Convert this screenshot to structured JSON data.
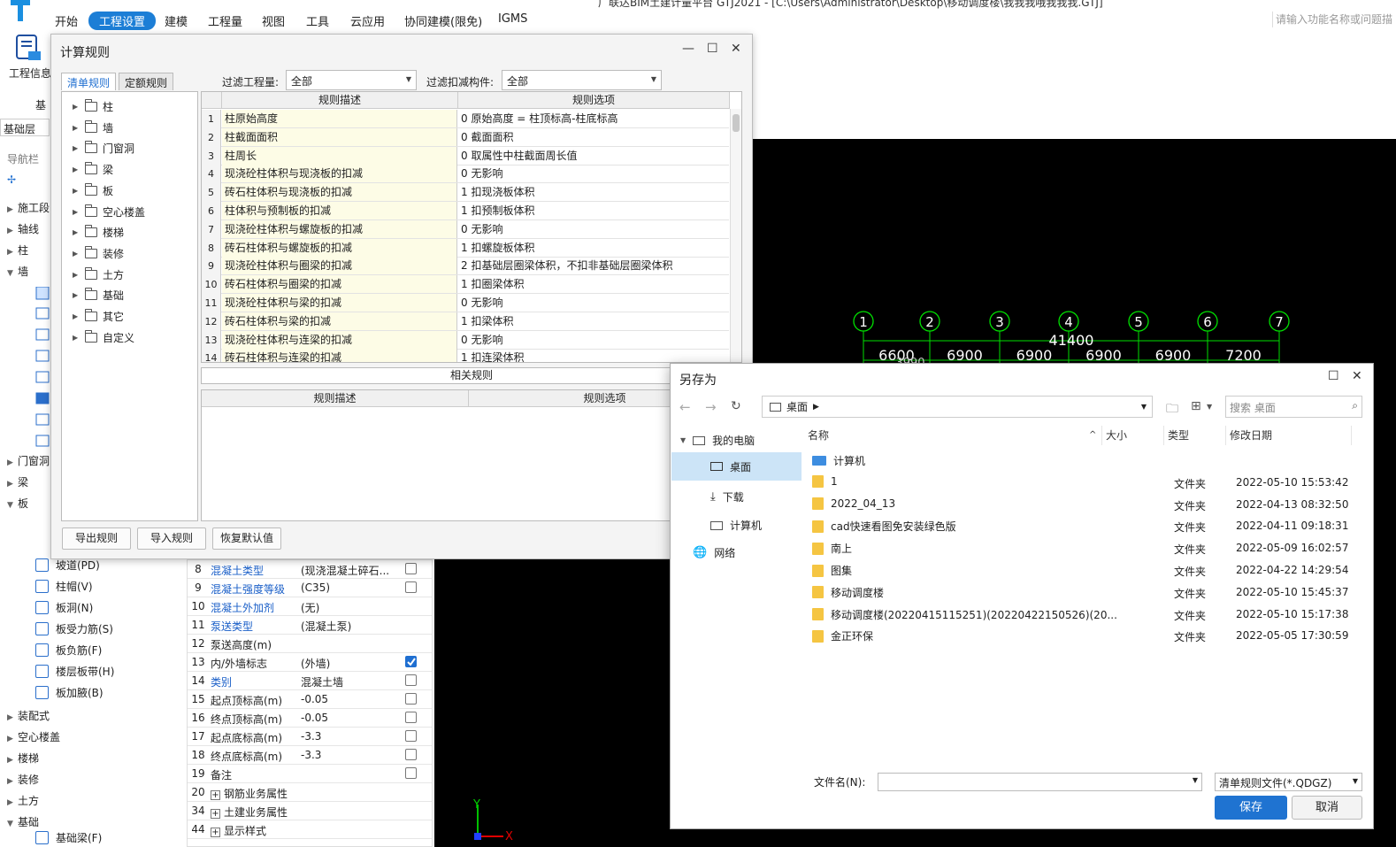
{
  "ribbon": {
    "title": "广联达BIM土建计量平台 GTJ2021 - [C:\\Users\\Administrator\\Desktop\\移动调度楼\\我我我哦我我我.GTJ]",
    "menus": [
      "开始",
      "工程设置",
      "建模",
      "工程量",
      "视图",
      "工具",
      "云应用",
      "协同建模(限免)",
      "IGMS"
    ],
    "active_menu": "工程设置",
    "search_placeholder": "请输入功能名称或问题描",
    "project_info": "工程信息"
  },
  "left": {
    "layer": "基础层",
    "nav_title": "导航栏",
    "truncated_label": "基",
    "nav_items": [
      "施工段",
      "轴线",
      "柱",
      "墙",
      "门窗洞",
      "梁",
      "板",
      "装配式",
      "空心楼盖",
      "楼梯",
      "装修",
      "土方",
      "基础"
    ],
    "board_subitems": [
      "坡道(PD)",
      "柱帽(V)",
      "板洞(N)",
      "板受力筋(S)",
      "板负筋(F)",
      "楼层板带(H)",
      "板加腋(B)"
    ],
    "foundation_subitem": "基础梁(F)"
  },
  "props": {
    "rows": [
      {
        "n": "8",
        "name": "混凝土类型",
        "val": "(现浇混凝土碎石...",
        "blue": true,
        "chk": false
      },
      {
        "n": "9",
        "name": "混凝土强度等级",
        "val": "(C35)",
        "blue": true,
        "chk": false
      },
      {
        "n": "10",
        "name": "混凝土外加剂",
        "val": "(无)",
        "blue": true,
        "chk": null
      },
      {
        "n": "11",
        "name": "泵送类型",
        "val": "(混凝土泵)",
        "blue": true,
        "chk": null
      },
      {
        "n": "12",
        "name": "泵送高度(m)",
        "val": "",
        "blue": false,
        "chk": null
      },
      {
        "n": "13",
        "name": "内/外墙标志",
        "val": "(外墙)",
        "blue": false,
        "chk": true
      },
      {
        "n": "14",
        "name": "类别",
        "val": "混凝土墙",
        "blue": true,
        "chk": false
      },
      {
        "n": "15",
        "name": "起点顶标高(m)",
        "val": "-0.05",
        "blue": false,
        "chk": false
      },
      {
        "n": "16",
        "name": "终点顶标高(m)",
        "val": "-0.05",
        "blue": false,
        "chk": false
      },
      {
        "n": "17",
        "name": "起点底标高(m)",
        "val": "-3.3",
        "blue": false,
        "chk": false
      },
      {
        "n": "18",
        "name": "终点底标高(m)",
        "val": "-3.3",
        "blue": false,
        "chk": false
      },
      {
        "n": "19",
        "name": "备注",
        "val": "",
        "blue": false,
        "chk": false
      },
      {
        "n": "20",
        "name": "钢筋业务属性",
        "val": "",
        "blue": false,
        "chk": null,
        "plus": true
      },
      {
        "n": "34",
        "name": "土建业务属性",
        "val": "",
        "blue": false,
        "chk": null,
        "plus": true
      },
      {
        "n": "44",
        "name": "显示样式",
        "val": "",
        "blue": false,
        "chk": null,
        "plus": true
      }
    ]
  },
  "cad": {
    "axes": [
      "1",
      "2",
      "3",
      "4",
      "5",
      "6",
      "7"
    ],
    "total": "41400",
    "spans": [
      "6600",
      "6900",
      "6900",
      "6900",
      "6900",
      "7200"
    ],
    "overlap_text": "3990",
    "y_axis": "Y",
    "x_axis": "X"
  },
  "rules_dialog": {
    "title": "计算规则",
    "tabs": [
      "清单规则",
      "定额规则"
    ],
    "filter_qty_label": "过滤工程量:",
    "filter_qty_value": "全部",
    "filter_deduct_label": "过滤扣减构件:",
    "filter_deduct_value": "全部",
    "tree": [
      "柱",
      "墙",
      "门窗洞",
      "梁",
      "板",
      "空心楼盖",
      "楼梯",
      "装修",
      "土方",
      "基础",
      "其它",
      "自定义"
    ],
    "col_desc": "规则描述",
    "col_opt": "规则选项",
    "rows": [
      {
        "n": "1",
        "desc": "柱原始高度",
        "opt": "0 原始高度 = 柱顶标高-柱底标高"
      },
      {
        "n": "2",
        "desc": "柱截面面积",
        "opt": "0 截面面积"
      },
      {
        "n": "3",
        "desc": "柱周长",
        "opt": "0 取属性中柱截面周长值"
      },
      {
        "n": "4",
        "desc": "现浇砼柱体积与现浇板的扣减",
        "opt": "0   无影响"
      },
      {
        "n": "5",
        "desc": "砖石柱体积与现浇板的扣减",
        "opt": "1 扣现浇板体积"
      },
      {
        "n": "6",
        "desc": "柱体积与预制板的扣减",
        "opt": "1 扣预制板体积"
      },
      {
        "n": "7",
        "desc": "现浇砼柱体积与螺旋板的扣减",
        "opt": "0   无影响"
      },
      {
        "n": "8",
        "desc": "砖石柱体积与螺旋板的扣减",
        "opt": "1 扣螺旋板体积"
      },
      {
        "n": "9",
        "desc": "现浇砼柱体积与圈梁的扣减",
        "opt": "2 扣基础层圈梁体积，不扣非基础层圈梁体积"
      },
      {
        "n": "10",
        "desc": "砖石柱体积与圈梁的扣减",
        "opt": "1 扣圈梁体积"
      },
      {
        "n": "11",
        "desc": "现浇砼柱体积与梁的扣减",
        "opt": "0   无影响"
      },
      {
        "n": "12",
        "desc": "砖石柱体积与梁的扣减",
        "opt": "1 扣梁体积"
      },
      {
        "n": "13",
        "desc": "现浇砼柱体积与连梁的扣减",
        "opt": "0   无影响"
      },
      {
        "n": "14",
        "desc": "砖石柱体积与连梁的扣减",
        "opt": "1 扣连梁体积"
      }
    ],
    "related": "相关规则",
    "buttons": {
      "export": "导出规则",
      "import": "导入规则",
      "reset": "恢复默认值"
    }
  },
  "save_dialog": {
    "title": "另存为",
    "path": "桌面",
    "search_placeholder": "搜索 桌面",
    "nav": {
      "pc": "我的电脑",
      "desktop": "桌面",
      "download": "下载",
      "computer": "计算机",
      "network": "网络"
    },
    "cols": {
      "name": "名称",
      "size": "大小",
      "type": "类型",
      "date": "修改日期"
    },
    "files": [
      {
        "name": "计算机",
        "type": "",
        "date": "",
        "kind": "pc"
      },
      {
        "name": "1",
        "type": "文件夹",
        "date": "2022-05-10 15:53:42",
        "kind": "folder"
      },
      {
        "name": "2022_04_13",
        "type": "文件夹",
        "date": "2022-04-13 08:32:50",
        "kind": "folder"
      },
      {
        "name": "cad快速看图免安装绿色版",
        "type": "文件夹",
        "date": "2022-04-11 09:18:31",
        "kind": "folder"
      },
      {
        "name": "南上",
        "type": "文件夹",
        "date": "2022-05-09 16:02:57",
        "kind": "folder"
      },
      {
        "name": "图集",
        "type": "文件夹",
        "date": "2022-04-22 14:29:54",
        "kind": "folder"
      },
      {
        "name": "移动调度楼",
        "type": "文件夹",
        "date": "2022-05-10 15:45:37",
        "kind": "folder"
      },
      {
        "name": "移动调度楼(20220415115251)(20220422150526)(20...",
        "type": "文件夹",
        "date": "2022-05-10 15:17:38",
        "kind": "folder"
      },
      {
        "name": "金正环保",
        "type": "文件夹",
        "date": "2022-05-05 17:30:59",
        "kind": "folder"
      }
    ],
    "filename_label": "文件名(N):",
    "filename_value": "",
    "filetype": "清单规则文件(*.QDGZ)",
    "save": "保存",
    "cancel": "取消"
  }
}
